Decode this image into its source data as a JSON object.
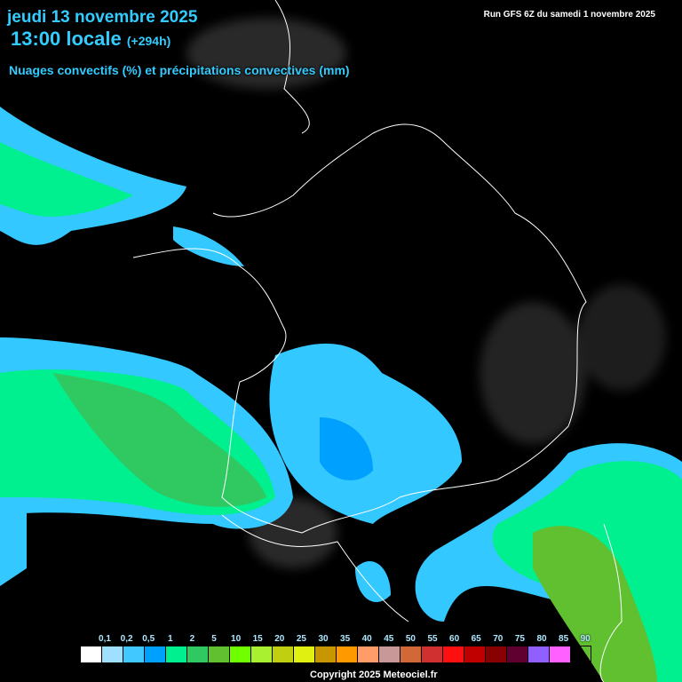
{
  "header": {
    "date": "jeudi 13 novembre 2025",
    "time": "13:00 locale",
    "lead": "(+294h)",
    "subtitle": "Nuages convectifs (%) et précipitations convectives (mm)",
    "run": "Run GFS 6Z du samedi 1 novembre 2025"
  },
  "legend": {
    "labels": [
      "0,1",
      "0,2",
      "0,5",
      "1",
      "2",
      "5",
      "10",
      "15",
      "20",
      "25",
      "30",
      "35",
      "40",
      "45",
      "50",
      "55",
      "60",
      "65",
      "70",
      "75",
      "80",
      "85",
      "90"
    ],
    "colors": [
      "#ffffff",
      "#a0e0ff",
      "#40c8ff",
      "#00a0ff",
      "#00f090",
      "#30c860",
      "#60c030",
      "#70ff00",
      "#a8f030",
      "#c0d010",
      "#e0f010",
      "#c89600",
      "#ff9900",
      "#ff9c68",
      "#c89898",
      "#d06838",
      "#d03030",
      "#ff1010",
      "#c00000",
      "#880000",
      "#600030",
      "#9060ff",
      "#ff60ff"
    ]
  },
  "footer": {
    "copyright": "Copyright 2025 Meteociel.fr"
  }
}
